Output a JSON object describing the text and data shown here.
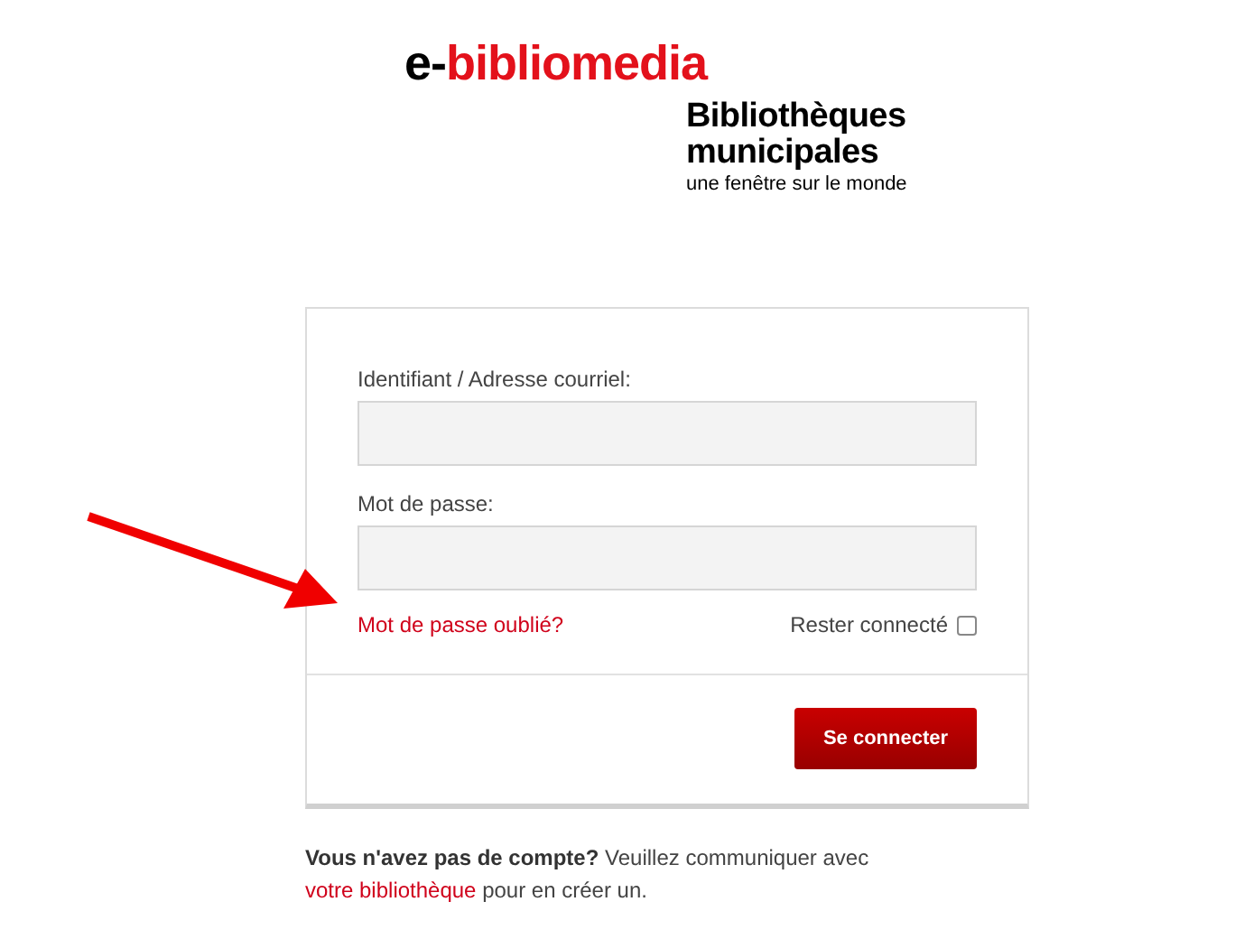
{
  "logo": {
    "prefix": "e-",
    "name": "bibliomedia",
    "title_line_1": "Bibliothèques",
    "title_line_2": "municipales",
    "tagline": "une fenêtre sur le monde"
  },
  "form": {
    "username_label": "Identifiant / Adresse courriel:",
    "password_label": "Mot de passe:",
    "forgot_link": "Mot de passe oublié?",
    "remember": {
      "label": "Rester connecté",
      "checked": false
    },
    "submit": "Se connecter"
  },
  "footer": {
    "bold": "Vous n'avez pas de compte?",
    "text": "Veuillez communiquer avec",
    "link": "votre bibliothèque",
    "end": "pour en créer un."
  }
}
